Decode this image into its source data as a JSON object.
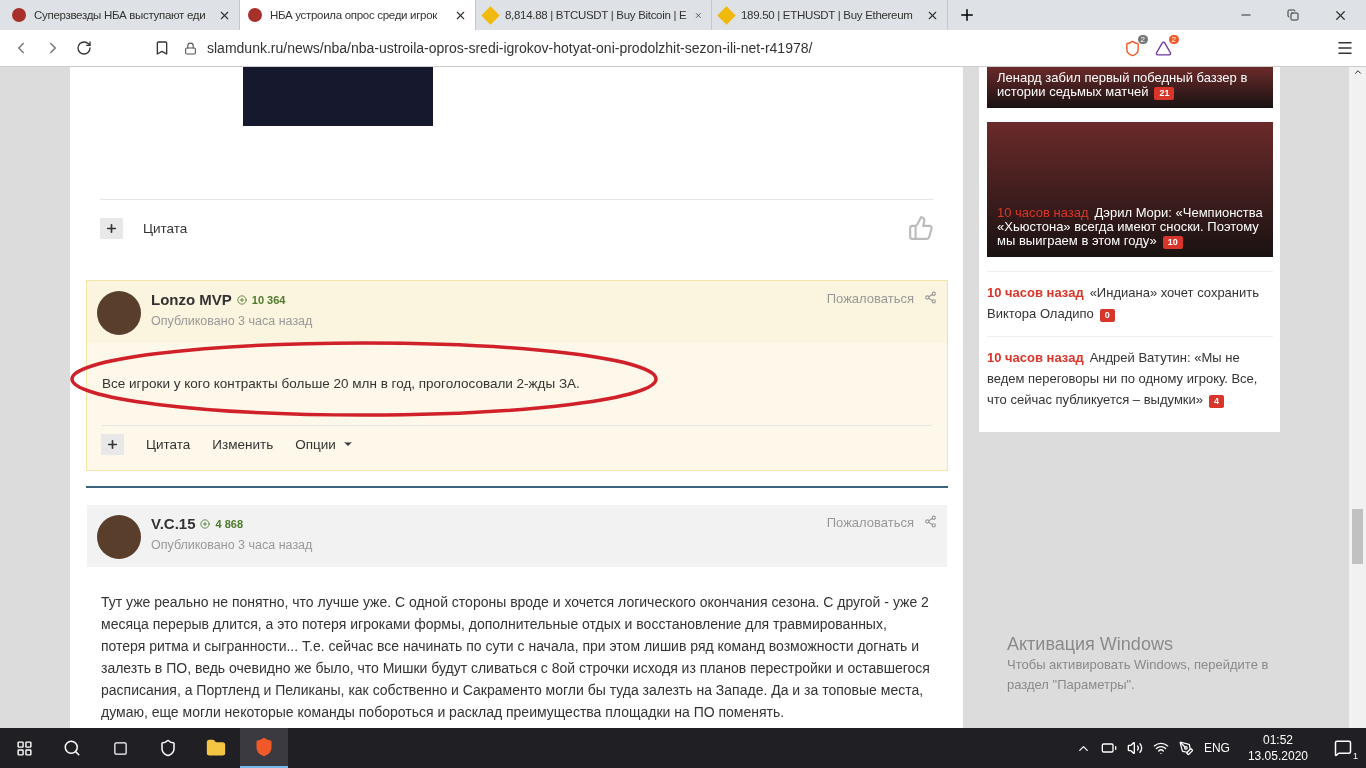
{
  "browser": {
    "tabs": [
      {
        "title": "Суперзвезды НБА выступают еди",
        "kind": "site",
        "selected": false
      },
      {
        "title": "НБА устроила опрос среди игрок",
        "kind": "site",
        "selected": true
      },
      {
        "title": "8,814.88 | BTCUSDT | Buy Bitcoin | E",
        "kind": "coin",
        "selected": false
      },
      {
        "title": "189.50 | ETHUSDT | Buy Ethereum",
        "kind": "coin",
        "selected": false
      }
    ],
    "url": "slamdunk.ru/news/nba/nba-ustroila-opros-sredi-igrokov-hotyat-oni-prodolzhit-sezon-ili-net-r41978/",
    "shield_count": "2",
    "rewards_count": "2"
  },
  "article_footer": {
    "quote": "Цитата"
  },
  "posts": [
    {
      "author": "Lonzo MVP",
      "reputation": "10 364",
      "published": "Опубликовано 3 часа назад",
      "report": "Пожаловаться",
      "highlighted": true,
      "body": "Все игроки у кого контракты больше 20 млн в год, проголосовали 2-жды ЗА.",
      "circled": true,
      "actions": [
        "Цитата",
        "Изменить",
        "Опции"
      ]
    },
    {
      "author": "V.C.15",
      "reputation": "4 868",
      "published": "Опубликовано 3 часа назад",
      "report": "Пожаловаться",
      "highlighted": false,
      "body": "Тут уже реально не понятно, что лучше уже. С одной стороны вроде и хочется логического окончания сезона. С другой - уже 2 месяца перерыв длится, а это потеря игроками формы, дополнительные отдых и восстановление для травмированных, потеря ритма и сыгранности... Т.е. сейчас все начинать по сути с начала, при этом лишив ряд команд возможности догнать и залезть в ПО, ведь очевидно же было, что Мишки будут сливаться с 8ой строчки исходя из планов перестройки и оставшегося расписания, а Портленд и Пеликаны, как собственно и Сакраменто могли бы туда залезть на Западе. Да и за топовые места, думаю, еще могли некоторые команды побороться и расклад преимущества площадки на ПО поменять."
    }
  ],
  "sidebar": {
    "news": [
      {
        "kind": "photo",
        "title": "Ленард забил первый победный баззер в истории седьмых матчей",
        "comments": "21"
      },
      {
        "kind": "photo",
        "time": "10 часов назад",
        "title": "Дэрил Мори: «Чемпионства «Хьюстона» всегда имеют сноски. Поэтому мы выиграем в этом году»",
        "comments": "10"
      },
      {
        "kind": "text",
        "time": "10 часов назад",
        "title": "«Индиана» хочет сохранить Виктора Оладипо",
        "comments": "0"
      },
      {
        "kind": "text",
        "time": "10 часов назад",
        "title": "Андрей Ватутин: «Мы не ведем переговоры ни по одному игроку. Все, что сейчас публикуется – выдумки»",
        "comments": "4"
      }
    ]
  },
  "activation": {
    "title": "Активация Windows",
    "text": "Чтобы активировать Windows, перейдите в раздел \"Параметры\"."
  },
  "taskbar": {
    "language": "ENG",
    "time": "01:52",
    "date": "13.05.2020",
    "notifications": "1"
  }
}
